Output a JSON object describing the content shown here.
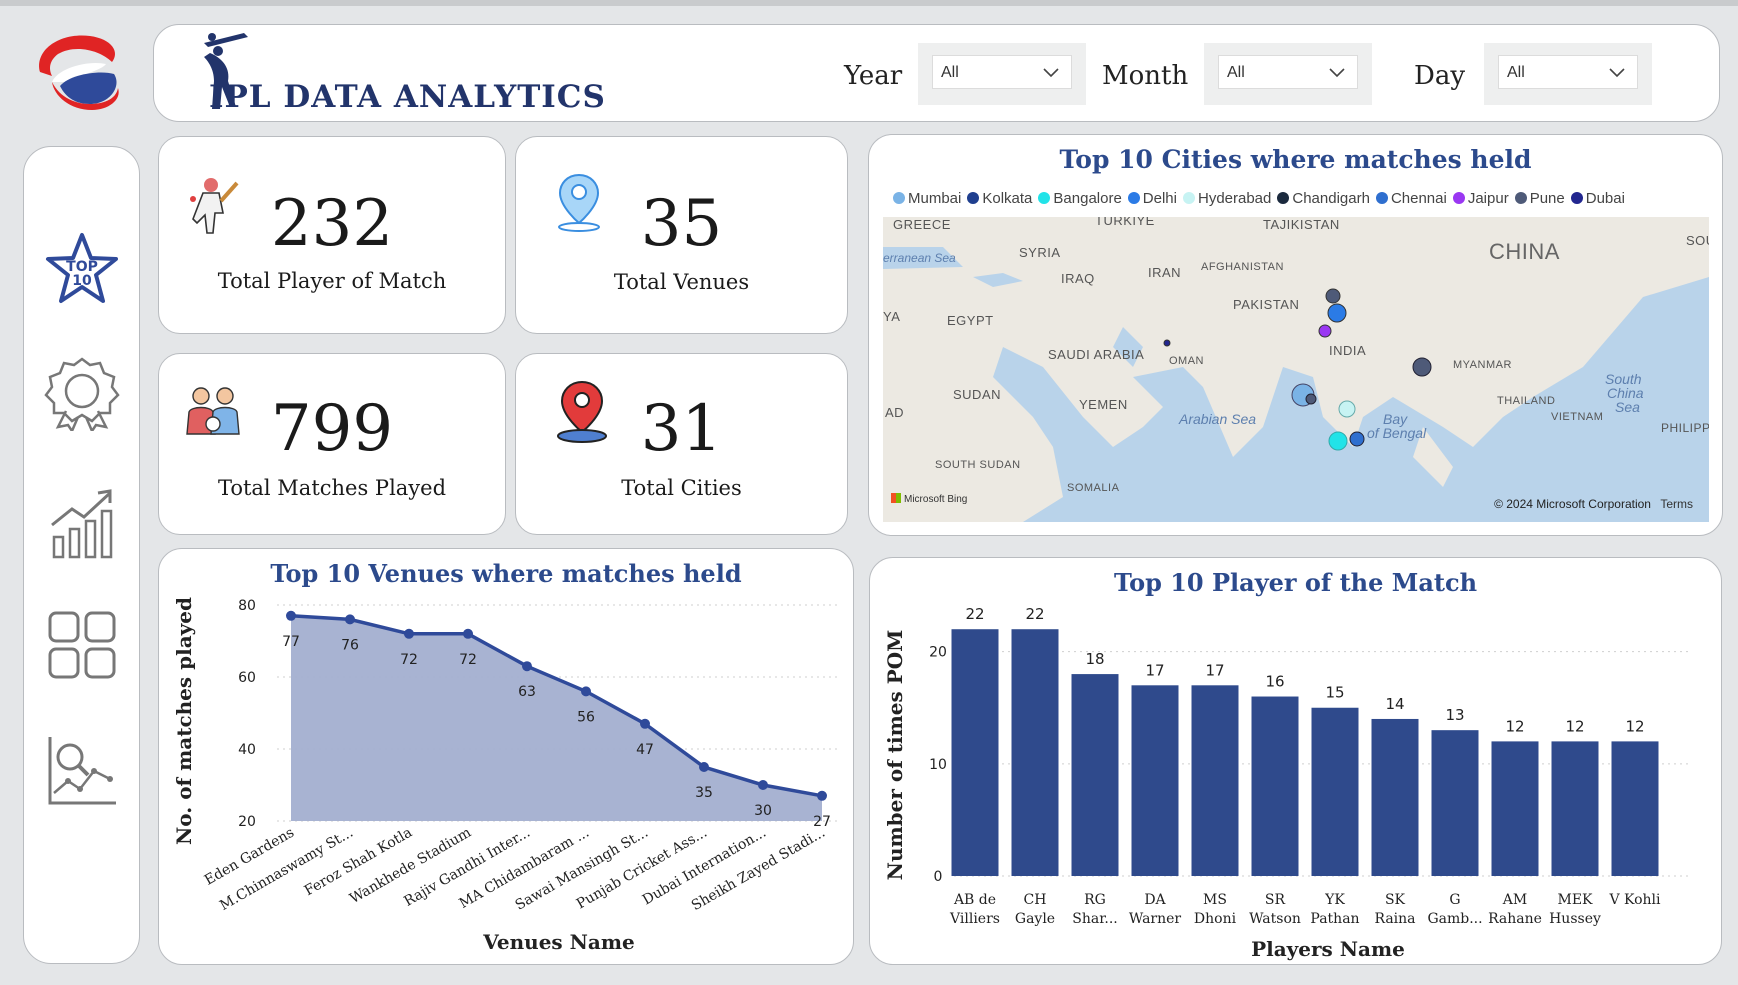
{
  "header": {
    "title": "IPL DATA ANALYTICS",
    "filters": [
      {
        "label": "Year",
        "value": "All"
      },
      {
        "label": "Month",
        "value": "All"
      },
      {
        "label": "Day",
        "value": "All"
      }
    ]
  },
  "kpis": [
    {
      "value": "232",
      "label": "Total Player of Match",
      "icon": "batsman-icon"
    },
    {
      "value": "35",
      "label": "Total Venues",
      "icon": "location-pin-icon"
    },
    {
      "value": "799",
      "label": "Total Matches Played",
      "icon": "players-icon"
    },
    {
      "value": "31",
      "label": "Total Cities",
      "icon": "map-pin-icon"
    }
  ],
  "sidebar": {
    "items": [
      {
        "name": "top-10-icon",
        "label": "TOP 10"
      },
      {
        "name": "award-badge-icon"
      },
      {
        "name": "growth-chart-icon"
      },
      {
        "name": "dashboard-grid-icon"
      },
      {
        "name": "analysis-icon"
      }
    ]
  },
  "map": {
    "title": "Top 10 Cities where matches held",
    "legend": [
      {
        "name": "Mumbai",
        "color": "#7ab3e6"
      },
      {
        "name": "Kolkata",
        "color": "#1f3f8f"
      },
      {
        "name": "Bangalore",
        "color": "#22e3e8"
      },
      {
        "name": "Delhi",
        "color": "#2b7be6"
      },
      {
        "name": "Hyderabad",
        "color": "#c7f3f3"
      },
      {
        "name": "Chandigarh",
        "color": "#1b2a3e"
      },
      {
        "name": "Chennai",
        "color": "#2f6fcf"
      },
      {
        "name": "Jaipur",
        "color": "#9a37f2"
      },
      {
        "name": "Pune",
        "color": "#4e5a78"
      },
      {
        "name": "Dubai",
        "color": "#22268f"
      }
    ],
    "labels": {
      "greece": "GREECE",
      "turkey": "TURKIYE",
      "tajikistan": "TAJIKISTAN",
      "china": "CHINA",
      "med": "erranean Sea",
      "syria": "SYRIA",
      "iraq": "IRAQ",
      "iran": "IRAN",
      "afghanistan": "AFGHANISTAN",
      "pakistan": "PAKISTAN",
      "ya": "YA",
      "egypt": "EGYPT",
      "saudi": "SAUDI ARABIA",
      "oman": "OMAN",
      "india": "INDIA",
      "myanmar": "MYANMAR",
      "scs1": "South",
      "scs2": "China",
      "scs3": "Sea",
      "sudan": "SUDAN",
      "yemen": "YEMEN",
      "thailand": "THAILAND",
      "vietnam": "VIETNAM",
      "ad": "AD",
      "arabian": "Arabian Sea",
      "bay1": "Bay",
      "bay2": "of Bengal",
      "philippines": "PHILIPPIN",
      "ssudan": "SOUTH SUDAN",
      "somalia": "SOMALIA",
      "sou": "SOU",
      "bing": "Microsoft Bing",
      "copyright": "© 2024 Microsoft Corporation",
      "terms": "Terms"
    }
  },
  "venues_chart": {
    "title": "Top 10 Venues where matches held",
    "xlabel": "Venues Name",
    "ylabel": "No. of matches played"
  },
  "pom_chart": {
    "title": "Top 10 Player of the Match",
    "xlabel": "Players Name",
    "ylabel": "Number of times POM"
  },
  "chart_data": [
    {
      "type": "area",
      "title": "Top 10 Venues where matches held",
      "xlabel": "Venues Name",
      "ylabel": "No. of matches played",
      "categories": [
        "Eden Gardens",
        "M.Chinnaswamy St...",
        "Feroz Shah Kotla",
        "Wankhede Stadium",
        "Rajiv Gandhi Inter...",
        "MA Chidambaram ...",
        "Sawai Mansingh St...",
        "Punjab Cricket Ass...",
        "Dubai Internation...",
        "Sheikh Zayed Stadi..."
      ],
      "values": [
        77,
        76,
        72,
        72,
        63,
        56,
        47,
        35,
        30,
        27
      ],
      "ylim": [
        20,
        80
      ],
      "yticks": [
        20,
        40,
        60,
        80
      ],
      "grid": true
    },
    {
      "type": "bar",
      "title": "Top 10 Player of the Match",
      "xlabel": "Players Name",
      "ylabel": "Number of times POM",
      "categories": [
        [
          "AB de",
          "Villiers"
        ],
        [
          "CH",
          "Gayle"
        ],
        [
          "RG",
          "Shar..."
        ],
        [
          "DA",
          "Warner"
        ],
        [
          "MS",
          "Dhoni"
        ],
        [
          "SR",
          "Watson"
        ],
        [
          "YK",
          "Pathan"
        ],
        [
          "SK",
          "Raina"
        ],
        [
          "G",
          "Gamb..."
        ],
        [
          "AM",
          "Rahane"
        ],
        [
          "MEK",
          "Hussey"
        ],
        [
          "V Kohli"
        ]
      ],
      "values": [
        22,
        22,
        18,
        17,
        17,
        16,
        15,
        14,
        13,
        12,
        12,
        12
      ],
      "ylim": [
        0,
        23
      ],
      "yticks": [
        0,
        10,
        20
      ],
      "grid": true
    }
  ]
}
